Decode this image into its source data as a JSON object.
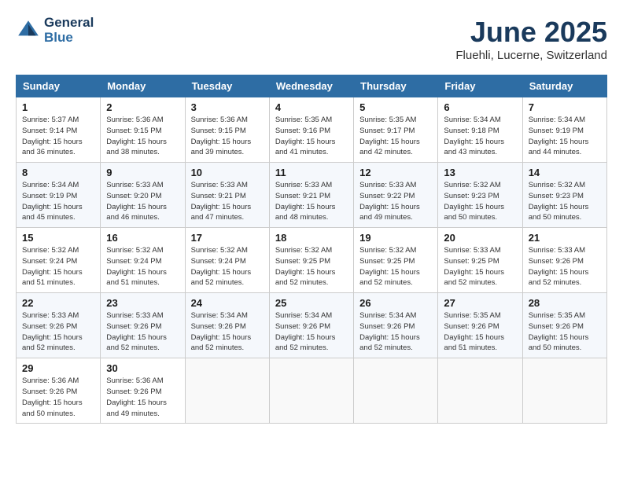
{
  "header": {
    "logo_general": "General",
    "logo_blue": "Blue",
    "month_year": "June 2025",
    "location": "Fluehli, Lucerne, Switzerland"
  },
  "weekdays": [
    "Sunday",
    "Monday",
    "Tuesday",
    "Wednesday",
    "Thursday",
    "Friday",
    "Saturday"
  ],
  "weeks": [
    [
      {
        "day": "1",
        "info": "Sunrise: 5:37 AM\nSunset: 9:14 PM\nDaylight: 15 hours\nand 36 minutes."
      },
      {
        "day": "2",
        "info": "Sunrise: 5:36 AM\nSunset: 9:15 PM\nDaylight: 15 hours\nand 38 minutes."
      },
      {
        "day": "3",
        "info": "Sunrise: 5:36 AM\nSunset: 9:15 PM\nDaylight: 15 hours\nand 39 minutes."
      },
      {
        "day": "4",
        "info": "Sunrise: 5:35 AM\nSunset: 9:16 PM\nDaylight: 15 hours\nand 41 minutes."
      },
      {
        "day": "5",
        "info": "Sunrise: 5:35 AM\nSunset: 9:17 PM\nDaylight: 15 hours\nand 42 minutes."
      },
      {
        "day": "6",
        "info": "Sunrise: 5:34 AM\nSunset: 9:18 PM\nDaylight: 15 hours\nand 43 minutes."
      },
      {
        "day": "7",
        "info": "Sunrise: 5:34 AM\nSunset: 9:19 PM\nDaylight: 15 hours\nand 44 minutes."
      }
    ],
    [
      {
        "day": "8",
        "info": "Sunrise: 5:34 AM\nSunset: 9:19 PM\nDaylight: 15 hours\nand 45 minutes."
      },
      {
        "day": "9",
        "info": "Sunrise: 5:33 AM\nSunset: 9:20 PM\nDaylight: 15 hours\nand 46 minutes."
      },
      {
        "day": "10",
        "info": "Sunrise: 5:33 AM\nSunset: 9:21 PM\nDaylight: 15 hours\nand 47 minutes."
      },
      {
        "day": "11",
        "info": "Sunrise: 5:33 AM\nSunset: 9:21 PM\nDaylight: 15 hours\nand 48 minutes."
      },
      {
        "day": "12",
        "info": "Sunrise: 5:33 AM\nSunset: 9:22 PM\nDaylight: 15 hours\nand 49 minutes."
      },
      {
        "day": "13",
        "info": "Sunrise: 5:32 AM\nSunset: 9:23 PM\nDaylight: 15 hours\nand 50 minutes."
      },
      {
        "day": "14",
        "info": "Sunrise: 5:32 AM\nSunset: 9:23 PM\nDaylight: 15 hours\nand 50 minutes."
      }
    ],
    [
      {
        "day": "15",
        "info": "Sunrise: 5:32 AM\nSunset: 9:24 PM\nDaylight: 15 hours\nand 51 minutes."
      },
      {
        "day": "16",
        "info": "Sunrise: 5:32 AM\nSunset: 9:24 PM\nDaylight: 15 hours\nand 51 minutes."
      },
      {
        "day": "17",
        "info": "Sunrise: 5:32 AM\nSunset: 9:24 PM\nDaylight: 15 hours\nand 52 minutes."
      },
      {
        "day": "18",
        "info": "Sunrise: 5:32 AM\nSunset: 9:25 PM\nDaylight: 15 hours\nand 52 minutes."
      },
      {
        "day": "19",
        "info": "Sunrise: 5:32 AM\nSunset: 9:25 PM\nDaylight: 15 hours\nand 52 minutes."
      },
      {
        "day": "20",
        "info": "Sunrise: 5:33 AM\nSunset: 9:25 PM\nDaylight: 15 hours\nand 52 minutes."
      },
      {
        "day": "21",
        "info": "Sunrise: 5:33 AM\nSunset: 9:26 PM\nDaylight: 15 hours\nand 52 minutes."
      }
    ],
    [
      {
        "day": "22",
        "info": "Sunrise: 5:33 AM\nSunset: 9:26 PM\nDaylight: 15 hours\nand 52 minutes."
      },
      {
        "day": "23",
        "info": "Sunrise: 5:33 AM\nSunset: 9:26 PM\nDaylight: 15 hours\nand 52 minutes."
      },
      {
        "day": "24",
        "info": "Sunrise: 5:34 AM\nSunset: 9:26 PM\nDaylight: 15 hours\nand 52 minutes."
      },
      {
        "day": "25",
        "info": "Sunrise: 5:34 AM\nSunset: 9:26 PM\nDaylight: 15 hours\nand 52 minutes."
      },
      {
        "day": "26",
        "info": "Sunrise: 5:34 AM\nSunset: 9:26 PM\nDaylight: 15 hours\nand 52 minutes."
      },
      {
        "day": "27",
        "info": "Sunrise: 5:35 AM\nSunset: 9:26 PM\nDaylight: 15 hours\nand 51 minutes."
      },
      {
        "day": "28",
        "info": "Sunrise: 5:35 AM\nSunset: 9:26 PM\nDaylight: 15 hours\nand 50 minutes."
      }
    ],
    [
      {
        "day": "29",
        "info": "Sunrise: 5:36 AM\nSunset: 9:26 PM\nDaylight: 15 hours\nand 50 minutes."
      },
      {
        "day": "30",
        "info": "Sunrise: 5:36 AM\nSunset: 9:26 PM\nDaylight: 15 hours\nand 49 minutes."
      },
      {
        "day": "",
        "info": ""
      },
      {
        "day": "",
        "info": ""
      },
      {
        "day": "",
        "info": ""
      },
      {
        "day": "",
        "info": ""
      },
      {
        "day": "",
        "info": ""
      }
    ]
  ]
}
